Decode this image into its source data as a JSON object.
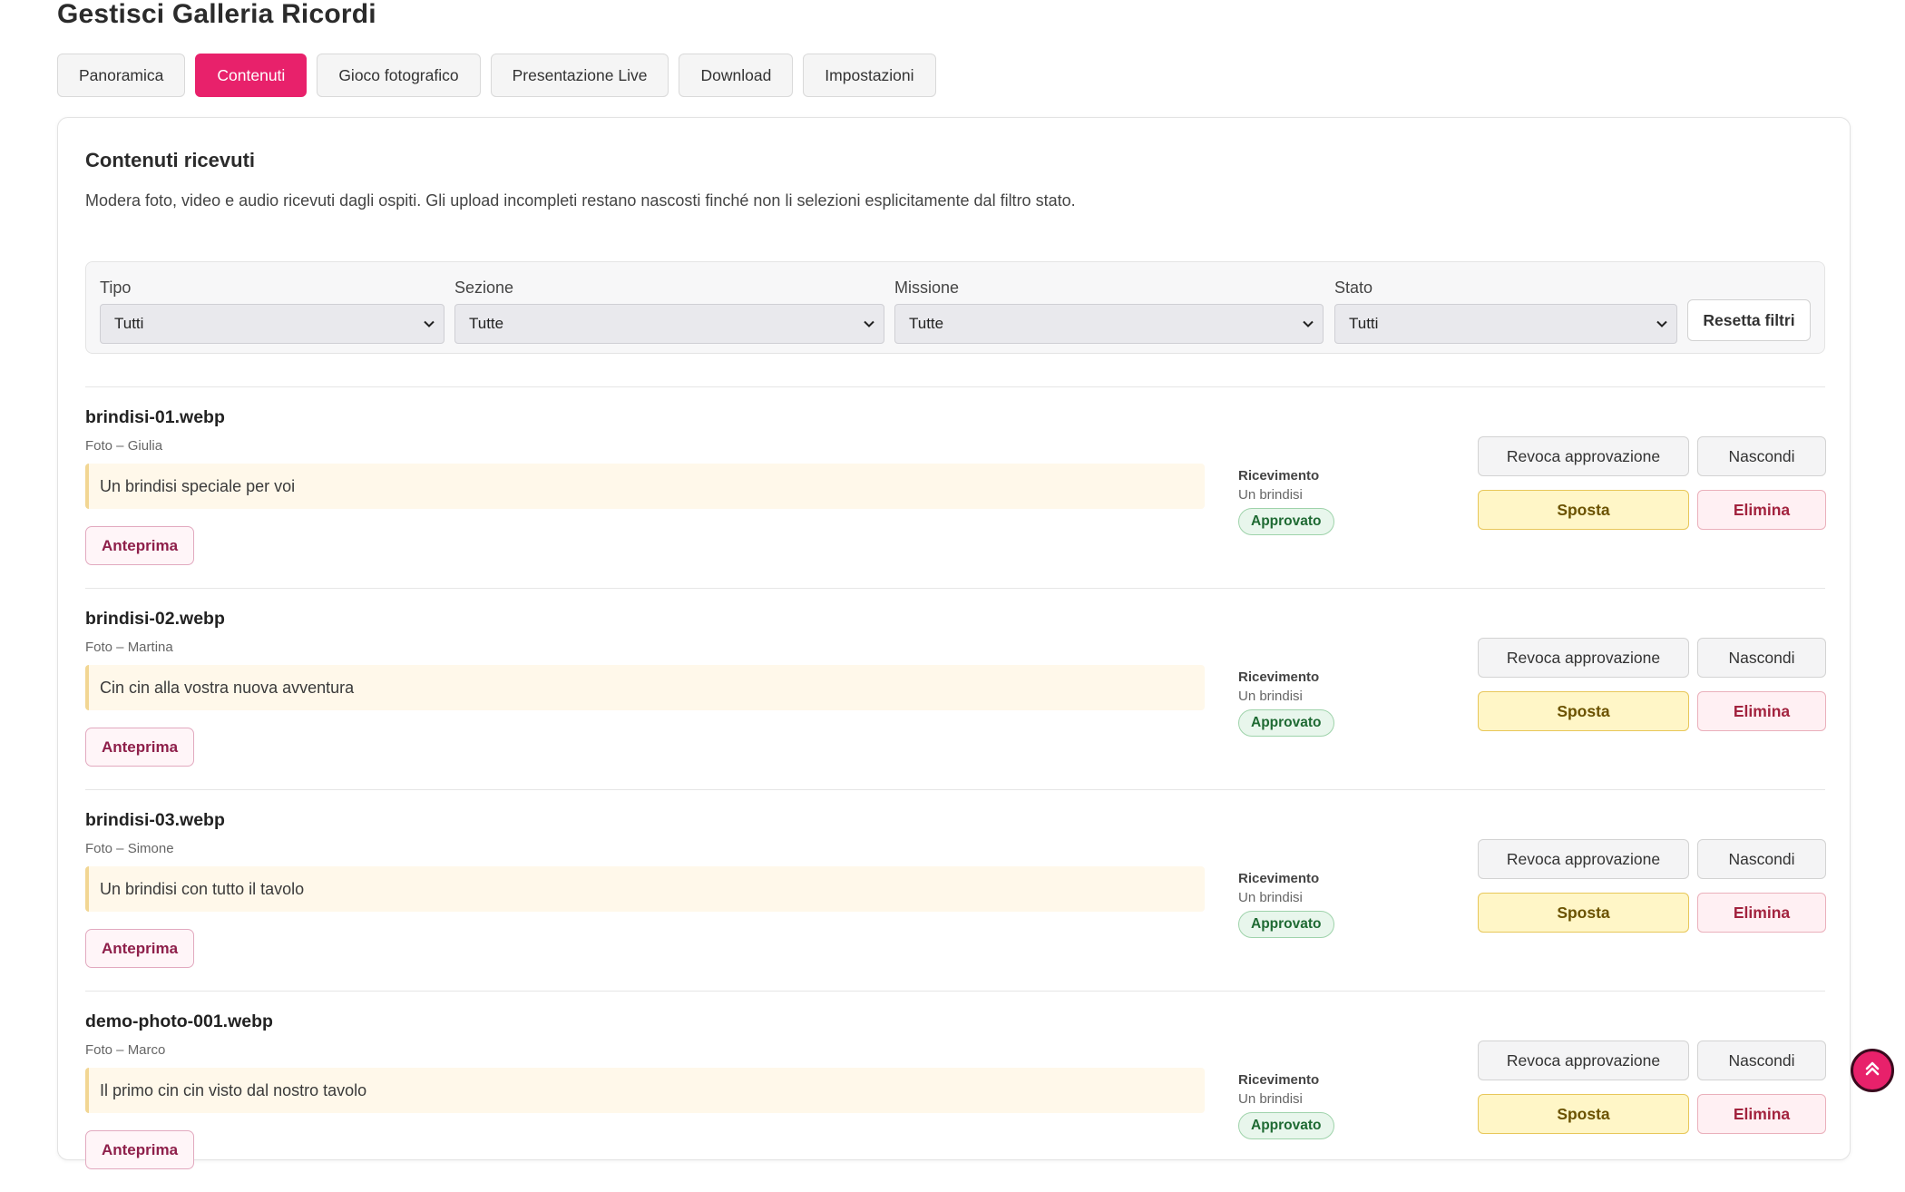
{
  "page": {
    "title": "Gestisci Galleria Ricordi"
  },
  "tabs": [
    {
      "label": "Panoramica",
      "active": false
    },
    {
      "label": "Contenuti",
      "active": true
    },
    {
      "label": "Gioco fotografico",
      "active": false
    },
    {
      "label": "Presentazione Live",
      "active": false
    },
    {
      "label": "Download",
      "active": false
    },
    {
      "label": "Impostazioni",
      "active": false
    }
  ],
  "section": {
    "title": "Contenuti ricevuti",
    "description": "Modera foto, video e audio ricevuti dagli ospiti. Gli upload incompleti restano nascosti finché non li selezioni esplicitamente dal filtro stato."
  },
  "filters": {
    "tipo": {
      "label": "Tipo",
      "value": "Tutti"
    },
    "sezione": {
      "label": "Sezione",
      "value": "Tutte"
    },
    "missione": {
      "label": "Missione",
      "value": "Tutte"
    },
    "stato": {
      "label": "Stato",
      "value": "Tutti"
    },
    "reset_label": "Resetta filtri"
  },
  "items": [
    {
      "filename": "brindisi-01.webp",
      "meta": "Foto – Giulia",
      "caption": "Un brindisi speciale per voi",
      "preview_label": "Anteprima",
      "section_label": "Ricevimento",
      "section_value": "Un brindisi",
      "status": "Approvato",
      "revoke_label": "Revoca approvazione",
      "hide_label": "Nascondi",
      "move_label": "Sposta",
      "delete_label": "Elimina"
    },
    {
      "filename": "brindisi-02.webp",
      "meta": "Foto – Martina",
      "caption": "Cin cin alla vostra nuova avventura",
      "preview_label": "Anteprima",
      "section_label": "Ricevimento",
      "section_value": "Un brindisi",
      "status": "Approvato",
      "revoke_label": "Revoca approvazione",
      "hide_label": "Nascondi",
      "move_label": "Sposta",
      "delete_label": "Elimina"
    },
    {
      "filename": "brindisi-03.webp",
      "meta": "Foto – Simone",
      "caption": "Un brindisi con tutto il tavolo",
      "preview_label": "Anteprima",
      "section_label": "Ricevimento",
      "section_value": "Un brindisi",
      "status": "Approvato",
      "revoke_label": "Revoca approvazione",
      "hide_label": "Nascondi",
      "move_label": "Sposta",
      "delete_label": "Elimina"
    },
    {
      "filename": "demo-photo-001.webp",
      "meta": "Foto – Marco",
      "caption": "Il primo cin cin visto dal nostro tavolo",
      "preview_label": "Anteprima",
      "section_label": "Ricevimento",
      "section_value": "Un brindisi",
      "status": "Approvato",
      "revoke_label": "Revoca approvazione",
      "hide_label": "Nascondi",
      "move_label": "Sposta",
      "delete_label": "Elimina"
    }
  ],
  "icons": {
    "select_arrow": "chevron-down-icon",
    "scroll_top": "double-chevron-up-icon"
  },
  "colors": {
    "accent": "#e8216b",
    "approved": "#1f6a33",
    "move": "#6b5200",
    "delete": "#a3243f"
  }
}
